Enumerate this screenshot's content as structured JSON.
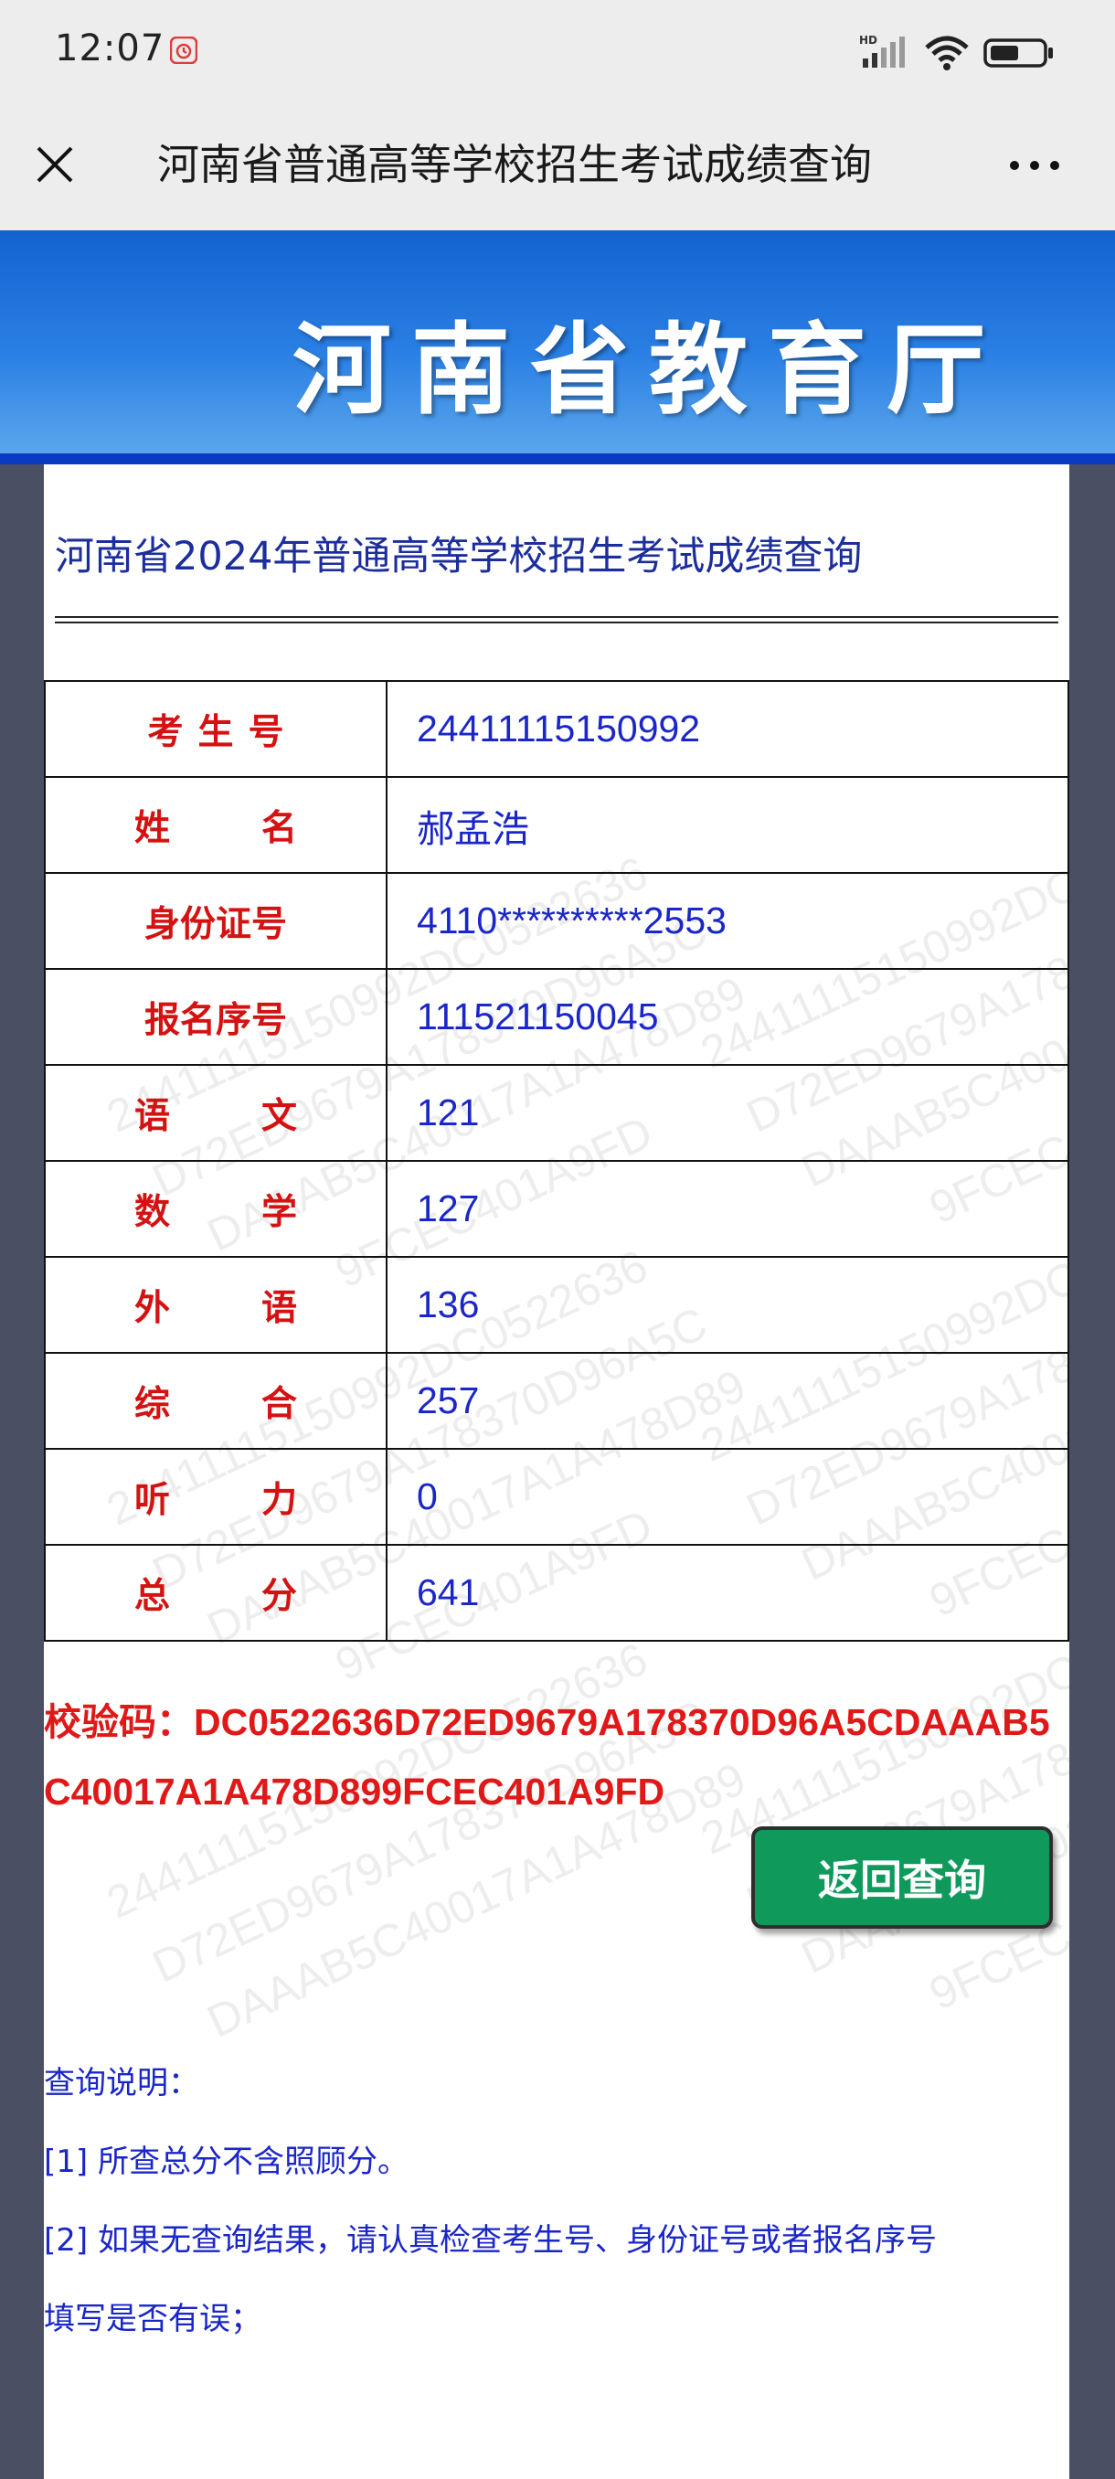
{
  "status_bar": {
    "time": "12:07"
  },
  "nav": {
    "title": "河南省普通高等学校招生考试成绩查询"
  },
  "banner": {
    "title": "河南省教育厅",
    "color": "#1363cf"
  },
  "page": {
    "heading": "河南省2024年普通高等学校招生考试成绩查询"
  },
  "table": {
    "rows": [
      {
        "label": "考生号",
        "value": "24411115150992"
      },
      {
        "label": "姓名",
        "value": "郝孟浩"
      },
      {
        "label": "身份证号",
        "value": "4110**********2553"
      },
      {
        "label": "报名序号",
        "value": "111521150045"
      },
      {
        "label": "语文",
        "value": "121"
      },
      {
        "label": "数学",
        "value": "127"
      },
      {
        "label": "外语",
        "value": "136"
      },
      {
        "label": "综合",
        "value": "257"
      },
      {
        "label": "听力",
        "value": "0"
      },
      {
        "label": "总分",
        "value": "641"
      }
    ]
  },
  "checksum": {
    "label": "校验码：",
    "code": "DC0522636D72ED9679A178370D96A5CDAAAB5C40017A1A478D899FCEC401A9FD"
  },
  "back_button": {
    "label": "返回查询",
    "color": "#0f9a5c"
  },
  "notes": {
    "title": "查询说明：",
    "lines": [
      "[1] 所查总分不含照顾分。",
      "[2] 如果无查询结果，请认真检查考生号、身份证号或者报名序号",
      "填写是否有误；"
    ]
  },
  "watermark": {
    "lines": [
      "24411115150992DC0522636",
      "D72ED9679A178370D96A5C",
      "DAAAB5C40017A1A478D89",
      "9FCEC401A9FD"
    ]
  },
  "colors": {
    "label_red": "#d41212",
    "value_blue": "#1a26c8",
    "checksum_red": "#e01818",
    "side_background": "#4a4f63"
  },
  "icons": [
    "alarm-icon",
    "signal-icon",
    "wifi-icon",
    "battery-icon",
    "close-icon",
    "more-icon"
  ]
}
